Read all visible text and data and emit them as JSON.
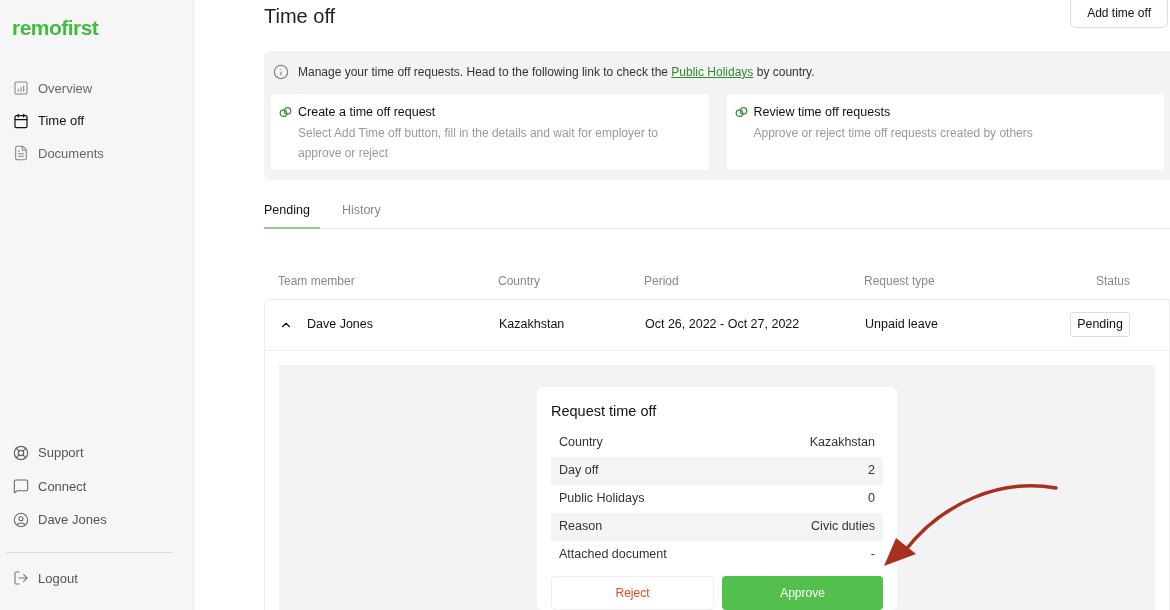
{
  "sidebar": {
    "logo": "remofirst",
    "nav": [
      {
        "label": "Overview",
        "selected": false
      },
      {
        "label": "Time off",
        "selected": true
      },
      {
        "label": "Documents",
        "selected": false
      }
    ],
    "bottom_nav": [
      {
        "label": "Support"
      },
      {
        "label": "Connect"
      },
      {
        "label": "Dave Jones"
      }
    ],
    "logout": "Logout"
  },
  "header": {
    "title": "Time off",
    "add_button": "Add time off"
  },
  "info": {
    "text_before": "Manage your time off requests. Head to the following link to check the",
    "link": "Public Holidays",
    "text_after": "by country.",
    "cards": [
      {
        "title": "Create a time off request",
        "description": "Select Add Time off button, fill in the details and wait for employer to approve or reject"
      },
      {
        "title": "Review time off requests",
        "description": "Approve or reject time off requests created by others"
      }
    ]
  },
  "tabs": [
    {
      "label": "Pending",
      "selected": true
    },
    {
      "label": "History",
      "selected": false
    }
  ],
  "table": {
    "columns": [
      "Team member",
      "Country",
      "Period",
      "Request type",
      "Status"
    ],
    "rows": [
      {
        "member": "Dave Jones",
        "country": "Kazakhstan",
        "period": "Oct 26, 2022 - Oct 27, 2022",
        "request_type": "Unpaid leave",
        "status": "Pending",
        "expanded": true
      }
    ]
  },
  "details": {
    "title": "Request time off",
    "fields": [
      {
        "label": "Country",
        "value": "Kazakhstan"
      },
      {
        "label": "Day off",
        "value": "2"
      },
      {
        "label": "Public Holidays",
        "value": "0"
      },
      {
        "label": "Reason",
        "value": "Civic duties"
      },
      {
        "label": "Attached document",
        "value": "-"
      }
    ],
    "reject": "Reject",
    "approve": "Approve"
  }
}
